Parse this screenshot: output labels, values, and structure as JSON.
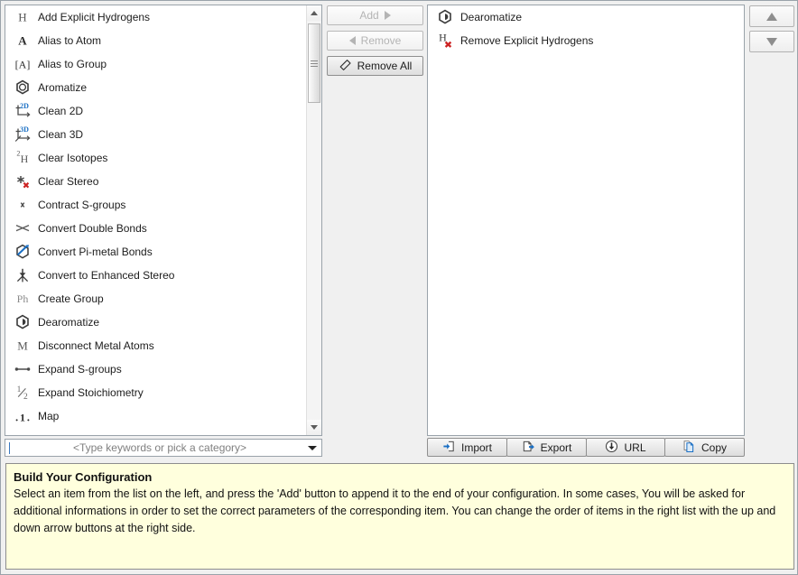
{
  "available_list": {
    "items": [
      {
        "label": "Add Explicit Hydrogens",
        "icon": "hydrogen-letter-icon"
      },
      {
        "label": "Alias to Atom",
        "icon": "atom-letter-icon"
      },
      {
        "label": "Alias to Group",
        "icon": "bracket-atom-icon"
      },
      {
        "label": "Aromatize",
        "icon": "aromatic-ring-icon"
      },
      {
        "label": "Clean 2D",
        "icon": "clean-2d-axes-icon"
      },
      {
        "label": "Clean 3D",
        "icon": "clean-3d-axes-icon"
      },
      {
        "label": "Clear Isotopes",
        "icon": "isotope-hydrogen-icon"
      },
      {
        "label": "Clear Stereo",
        "icon": "stereo-star-cross-icon"
      },
      {
        "label": "Contract S-groups",
        "icon": "contract-sgroup-icon"
      },
      {
        "label": "Convert Double Bonds",
        "icon": "double-bond-cross-icon"
      },
      {
        "label": "Convert Pi-metal Bonds",
        "icon": "pi-metal-bond-icon"
      },
      {
        "label": "Convert to Enhanced Stereo",
        "icon": "enhanced-stereo-icon"
      },
      {
        "label": "Create Group",
        "icon": "phenyl-group-icon"
      },
      {
        "label": "Dearomatize",
        "icon": "dearomatize-ring-icon"
      },
      {
        "label": "Disconnect Metal Atoms",
        "icon": "metal-letter-icon"
      },
      {
        "label": "Expand S-groups",
        "icon": "expand-sgroup-icon"
      },
      {
        "label": "Expand Stoichiometry",
        "icon": "one-half-fraction-icon"
      },
      {
        "label": "Map",
        "icon": "map-number-icon"
      }
    ]
  },
  "transfer_buttons": {
    "add": {
      "label": "Add",
      "enabled": false
    },
    "remove": {
      "label": "Remove",
      "enabled": false
    },
    "remove_all": {
      "label": "Remove All",
      "enabled": true
    }
  },
  "configuration_list": {
    "items": [
      {
        "label": "Dearomatize",
        "icon": "dearomatize-ring-icon"
      },
      {
        "label": "Remove Explicit Hydrogens",
        "icon": "remove-hydrogen-icon"
      }
    ]
  },
  "order_buttons": {
    "move_up": "move-up-arrow-icon",
    "move_down": "move-down-arrow-icon"
  },
  "io_buttons": [
    {
      "label": "Import",
      "icon": "import-icon"
    },
    {
      "label": "Export",
      "icon": "export-icon"
    },
    {
      "label": "URL",
      "icon": "url-download-icon"
    },
    {
      "label": "Copy",
      "icon": "copy-icon"
    }
  ],
  "category_combo": {
    "placeholder": "<Type keywords or pick a category>",
    "value": ""
  },
  "info_panel": {
    "title": "Build Your Configuration",
    "body": "Select an item from the list on the left, and press the 'Add' button to append it to the end of your configuration. In some cases, You will be asked for additional informations in order to set the correct parameters of the corresponding item. You can change the order of items in the right list with the up and down arrow buttons at the right side."
  },
  "colors": {
    "window_background": "#f0f0f0",
    "list_background": "#ffffff",
    "border": "#9aa3aa",
    "info_background": "#ffffdd",
    "accent_blue": "#1a6fc4",
    "danger_red": "#cc2222",
    "disabled_text": "#b4b4b4"
  }
}
